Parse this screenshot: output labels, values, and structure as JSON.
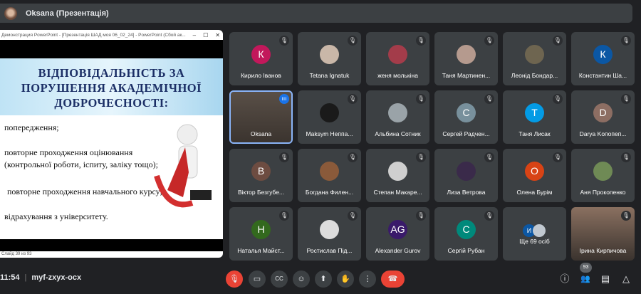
{
  "header": {
    "presenter": "Oksana (Презентація)"
  },
  "presentation": {
    "window_title": "Демонстрация PowerPoint - [Презентація ШАД моя 06_02_24] - PowerPoint (Сбой ак...",
    "slide_title": "ВІДПОВІДАЛЬНІСТЬ ЗА ПОРУШЕННЯ АКАДЕМІЧНОЇ ДОБРОЧЕСНОСТІ:",
    "bullets": [
      "попередження;",
      "повторне проходження оцінювання",
      "(контрольної роботи, іспиту, заліку тощо);",
      "повторне проходження навчального курсу;",
      "відрахування з університету."
    ],
    "status": "Слайд 39 из 93"
  },
  "participants": [
    {
      "name": "Кирило Іванов",
      "initial": "К",
      "color": "#c2185b"
    },
    {
      "name": "Tetana Ignatuk",
      "initial": "",
      "color": "#c9b7a8"
    },
    {
      "name": "женя молькіна",
      "initial": "",
      "color": "#a33c4a"
    },
    {
      "name": "Таня Мартинен...",
      "initial": "",
      "color": "#b59a8e"
    },
    {
      "name": "Леонід Бондар...",
      "initial": "",
      "color": "#6e6550"
    },
    {
      "name": "Константин Ша...",
      "initial": "К",
      "color": "#0b57a4"
    },
    {
      "name": "Oksana",
      "initial": "",
      "color": "#5a5048",
      "video": true,
      "speaking": true
    },
    {
      "name": "Maksym Неппа...",
      "initial": "",
      "color": "#1a1a1a"
    },
    {
      "name": "Альбина Сотник",
      "initial": "",
      "color": "#9aa3a8"
    },
    {
      "name": "Сергей Радчен...",
      "initial": "С",
      "color": "#78909c"
    },
    {
      "name": "Таня Лисак",
      "initial": "Т",
      "color": "#039be5"
    },
    {
      "name": "Darya Kопопеп...",
      "initial": "D",
      "color": "#8d6e63"
    },
    {
      "name": "Віктор Безгубе...",
      "initial": "В",
      "color": "#6d4c41"
    },
    {
      "name": "Богдана Филен...",
      "initial": "",
      "color": "#8a5a3a"
    },
    {
      "name": "Степан Макаре...",
      "initial": "",
      "color": "#cfcfcf"
    },
    {
      "name": "Лиза Ветрова",
      "initial": "",
      "color": "#3a2a4a"
    },
    {
      "name": "Олена Бурім",
      "initial": "О",
      "color": "#d84315"
    },
    {
      "name": "Аня Прокопенко",
      "initial": "",
      "color": "#6f8a55"
    },
    {
      "name": "Наталья Майст...",
      "initial": "Н",
      "color": "#33691e"
    },
    {
      "name": "Ростислав Під...",
      "initial": "",
      "color": "#dcdcdc"
    },
    {
      "name": "Alexander Gurov",
      "initial": "AG",
      "color": "#3a1a6a"
    },
    {
      "name": "Сергій Рубан",
      "initial": "С",
      "color": "#00897b"
    },
    {
      "name": "Ще 69 осіб",
      "initial": "И",
      "color": "#0b57a4",
      "more": true
    },
    {
      "name": "Ірина Кирпичова",
      "initial": "",
      "color": "#8a7060",
      "video": true
    }
  ],
  "footer": {
    "time": "11:54",
    "meeting_code": "myf-zxyx-ocx",
    "participant_count": "93"
  },
  "icons": {
    "mic_off": "🎙",
    "camera": "▭",
    "captions": "CC",
    "emoji": "☺",
    "present": "⬆",
    "hand": "✋",
    "more": "⋮",
    "end": "☎",
    "info": "ⓘ",
    "people": "👥",
    "chat": "▤",
    "activities": "△"
  }
}
